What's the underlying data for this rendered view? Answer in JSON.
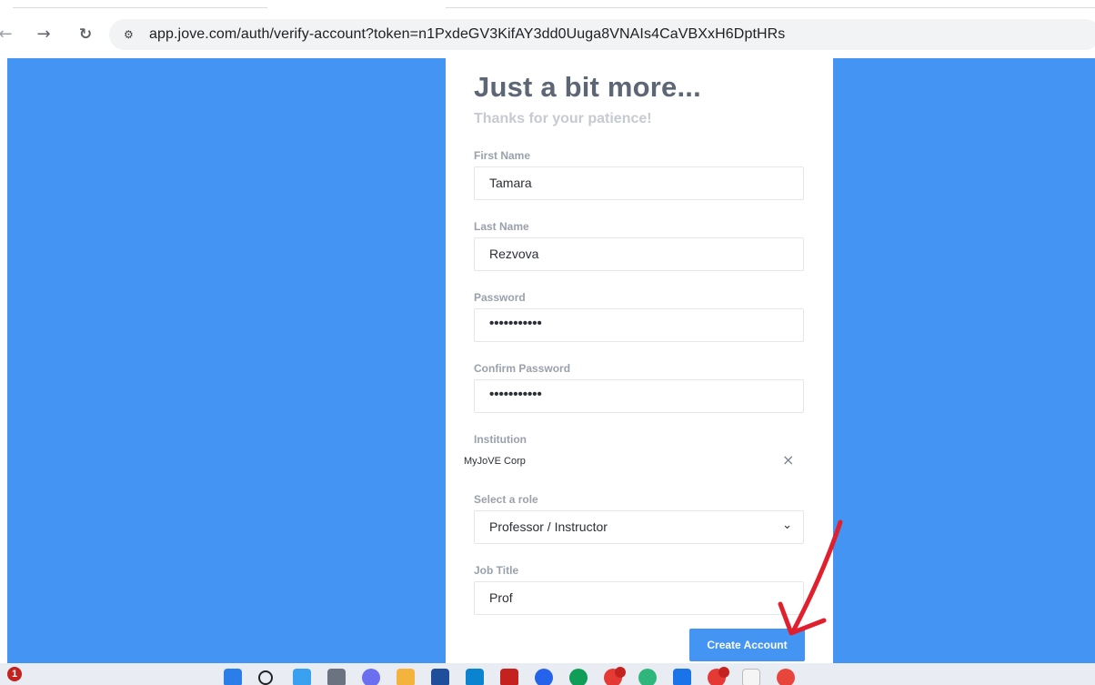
{
  "browser": {
    "url": "app.jove.com/auth/verify-account?token=n1PxdeGV3KifAY3dd0Uuga8VNAIs4CaVBXxH6DptHRs"
  },
  "form": {
    "title": "Just a bit more...",
    "subtitle": "Thanks for your patience!",
    "first_name": {
      "label": "First Name",
      "value": "Tamara"
    },
    "last_name": {
      "label": "Last Name",
      "value": "Rezvova"
    },
    "password": {
      "label": "Password",
      "value": "•••••••••••"
    },
    "confirm_password": {
      "label": "Confirm Password",
      "value": "•••••••••••"
    },
    "institution": {
      "label": "Institution",
      "value": "MyJoVE Corp",
      "clear_icon": "×"
    },
    "role": {
      "label": "Select a role",
      "value": "Professor / Instructor",
      "chevron": "⌄"
    },
    "job_title": {
      "label": "Job Title",
      "value": "Prof"
    },
    "submit_label": "Create Account"
  },
  "taskbar": {
    "notification_count": "1"
  },
  "colors": {
    "background_blue": "#4494f4",
    "button_blue": "#4494f4",
    "annotation_arrow": "#e0202e"
  }
}
